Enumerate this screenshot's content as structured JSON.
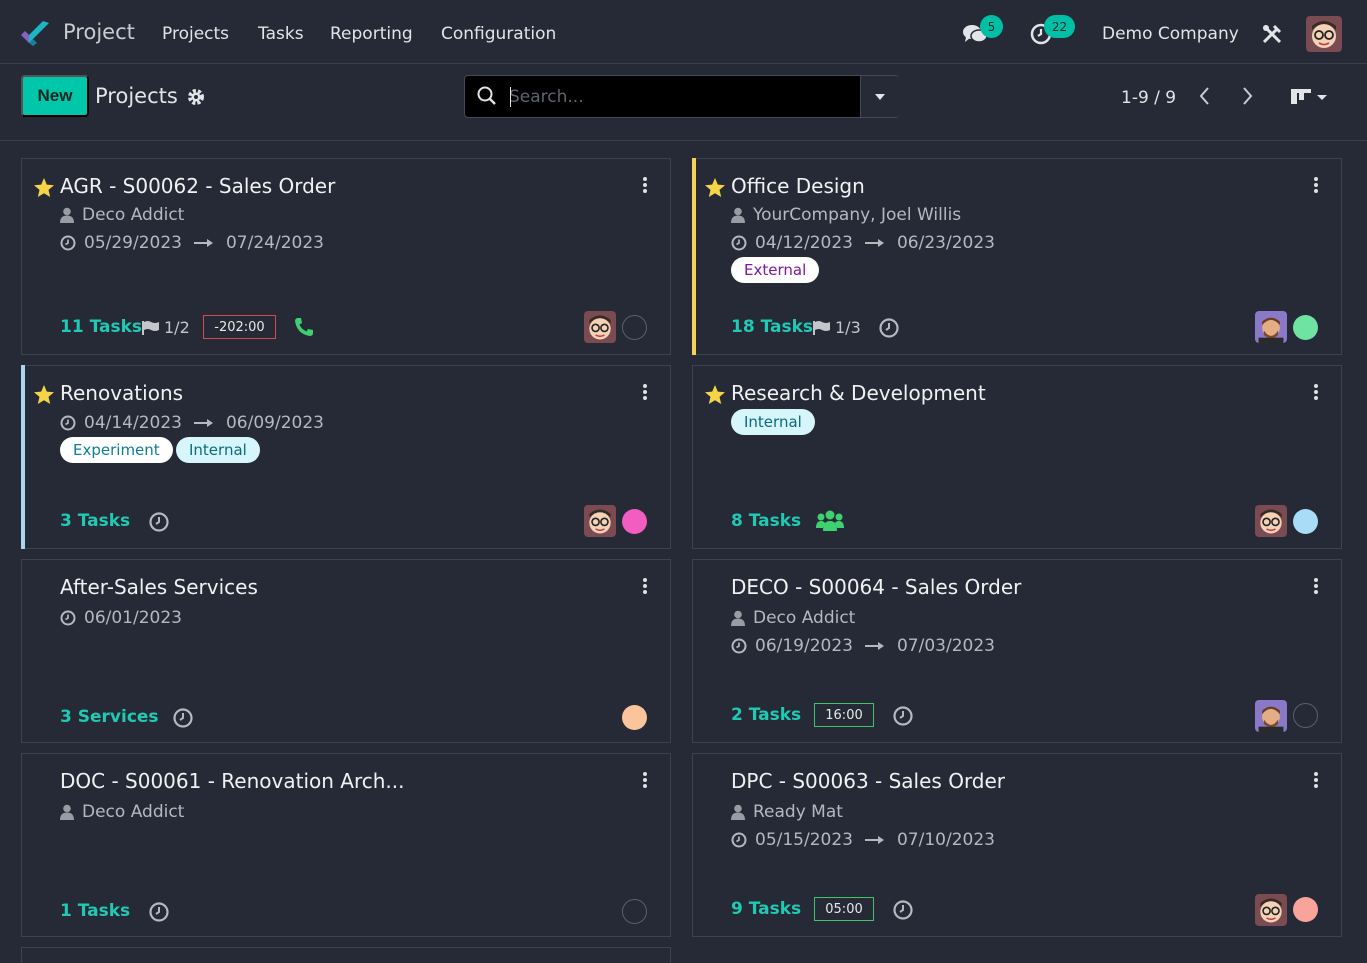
{
  "nav": {
    "app_title": "Project",
    "menu": [
      "Projects",
      "Tasks",
      "Reporting",
      "Configuration"
    ],
    "messages_count": "5",
    "activities_count": "22",
    "company": "Demo Company",
    "accent": "#00bfa5"
  },
  "control": {
    "new_label": "New",
    "breadcrumb": "Projects",
    "search_placeholder": "Search...",
    "pager": "1-9 / 9"
  },
  "cards": [
    {
      "title": "AGR - S00062 - Sales Order",
      "favorite": true,
      "customer": "Deco Addict",
      "start": "05/29/2023",
      "end": "07/24/2023",
      "tasks": "11 Tasks",
      "milestones": "1/2",
      "time": "-202:00"
    },
    {
      "title": "Office Design",
      "favorite": true,
      "customer": "YourCompany, Joel Willis",
      "start": "04/12/2023",
      "end": "06/23/2023",
      "tags": [
        "External"
      ],
      "tasks": "18 Tasks",
      "milestones": "1/3",
      "accent_color": "#f7d057"
    },
    {
      "title": "Renovations",
      "favorite": true,
      "start": "04/14/2023",
      "end": "06/09/2023",
      "tags": [
        "Experiment",
        "Internal"
      ],
      "tasks": "3 Tasks",
      "accent_color": "#a9d6ee"
    },
    {
      "title": "Research & Development",
      "favorite": true,
      "tags": [
        "Internal"
      ],
      "tasks": "8 Tasks"
    },
    {
      "title": "After-Sales Services",
      "favorite": false,
      "start": "06/01/2023",
      "tasks": "3 Services"
    },
    {
      "title": "DECO - S00064 - Sales Order",
      "favorite": false,
      "customer": "Deco Addict",
      "start": "06/19/2023",
      "end": "07/03/2023",
      "tasks": "2 Tasks",
      "time": "16:00"
    },
    {
      "title": "DOC - S00061 - Renovation Arch...",
      "favorite": false,
      "customer": "Deco Addict",
      "tasks": "1 Tasks"
    },
    {
      "title": "DPC - S00063 - Sales Order",
      "favorite": false,
      "customer": "Ready Mat",
      "start": "05/15/2023",
      "end": "07/10/2023",
      "tasks": "9 Tasks",
      "time": "05:00"
    }
  ]
}
